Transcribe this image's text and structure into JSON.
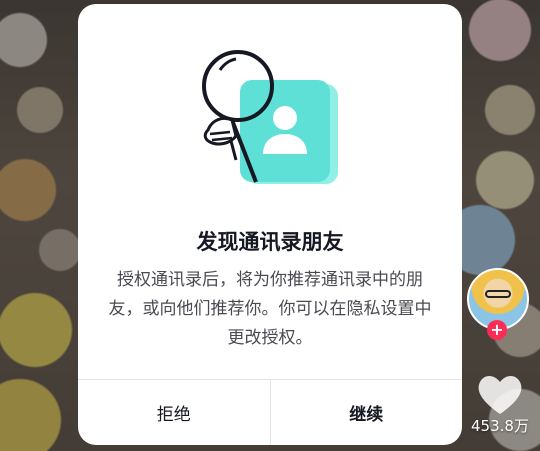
{
  "dialog": {
    "title": "发现通讯录朋友",
    "description": "授权通讯录后，将为你推荐通讯录中的朋友，或向他们推荐你。你可以在隐私设置中更改授权。",
    "reject_label": "拒绝",
    "continue_label": "继续",
    "illustration": "magnifier-contact-book-icon"
  },
  "overlay": {
    "like_count": "453.8万",
    "follow_symbol": "+",
    "accent_color": "#fe2c55"
  },
  "colors": {
    "contact_book": "#5fe0d6",
    "title_text": "#161823"
  }
}
